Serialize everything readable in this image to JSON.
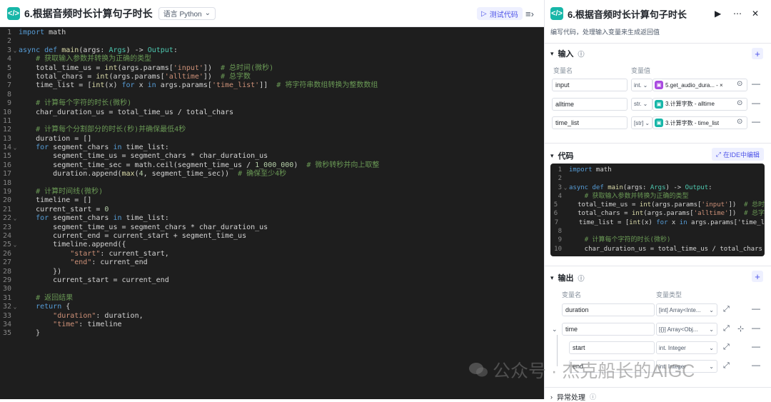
{
  "editor": {
    "title": "6.根据音频时长计算句子时长",
    "language_label": "语言 Python",
    "test_button": "测试代码",
    "code_lines": [
      "import math",
      "",
      "async def main(args: Args) -> Output:",
      "    # 获取输入参数并转换为正确的类型",
      "    total_time_us = int(args.params['input'])  # 总时间(微秒)",
      "    total_chars = int(args.params['alltime'])  # 总字数",
      "    time_list = [int(x) for x in args.params['time_list']]  # 将字符串数组转换为整数数组",
      "",
      "    # 计算每个字符的时长(微秒)",
      "    char_duration_us = total_time_us / total_chars",
      "",
      "    # 计算每个分割部分的时长(秒)并确保最低4秒",
      "    duration = []",
      "    for segment_chars in time_list:",
      "        segment_time_us = segment_chars * char_duration_us",
      "        segment_time_sec = math.ceil(segment_time_us / 1_000_000)  # 微秒转秒并向上取整",
      "        duration.append(max(4, segment_time_sec))  # 确保至少4秒",
      "",
      "    # 计算时间线(微秒)",
      "    timeline = []",
      "    current_start = 0",
      "    for segment_chars in time_list:",
      "        segment_time_us = segment_chars * char_duration_us",
      "        current_end = current_start + segment_time_us",
      "        timeline.append({",
      "            \"start\": current_start,",
      "            \"end\": current_end",
      "        })",
      "        current_start = current_end",
      "",
      "    # 返回结果",
      "    return {",
      "        \"duration\": duration,",
      "        \"time\": timeline",
      "    }"
    ]
  },
  "panel": {
    "title": "6.根据音频时长计算句子时长",
    "description": "编写代码，处理输入变量来生成返回值",
    "input_section": "输入",
    "col_var_name": "变量名",
    "col_var_value": "变量值",
    "inputs": [
      {
        "name": "input",
        "type": "int.",
        "ref": "5.get_audio_dura... - ×",
        "tag_color": "#a94be0"
      },
      {
        "name": "alltime",
        "type": "str.",
        "ref": "3.计算字数 - alltime",
        "tag_color": "#17b6a8"
      },
      {
        "name": "time_list",
        "type": "[str]",
        "ref": "3.计算字数 - time_list",
        "tag_color": "#17b6a8"
      }
    ],
    "code_section": "代码",
    "ide_button": "在IDE中编辑",
    "mini_code_lines": [
      "import math",
      "",
      "async def main(args: Args) -> Output:",
      "    # 获取输入参数并转换为正确的类型",
      "    total_time_us = int(args.params['input'])  # 总时",
      "    total_chars = int(args.params['alltime'])  # 总字",
      "    time_list = [int(x) for x in args.params['time_l",
      "",
      "    # 计算每个字符的时长(微秒)",
      "    char_duration_us = total_time_us / total_chars"
    ],
    "output_section": "输出",
    "col_var_type": "变量类型",
    "outputs": [
      {
        "name": "duration",
        "type": "[int] Array<Inte..."
      },
      {
        "name": "time",
        "type": "[{}] Array<Obj..."
      },
      {
        "name": "start",
        "type": "int. Integer"
      },
      {
        "name": "end",
        "type": "int. Integer"
      }
    ],
    "error_section": "异常处理"
  },
  "watermark": "公众号 · 杰克船长的AIGC"
}
